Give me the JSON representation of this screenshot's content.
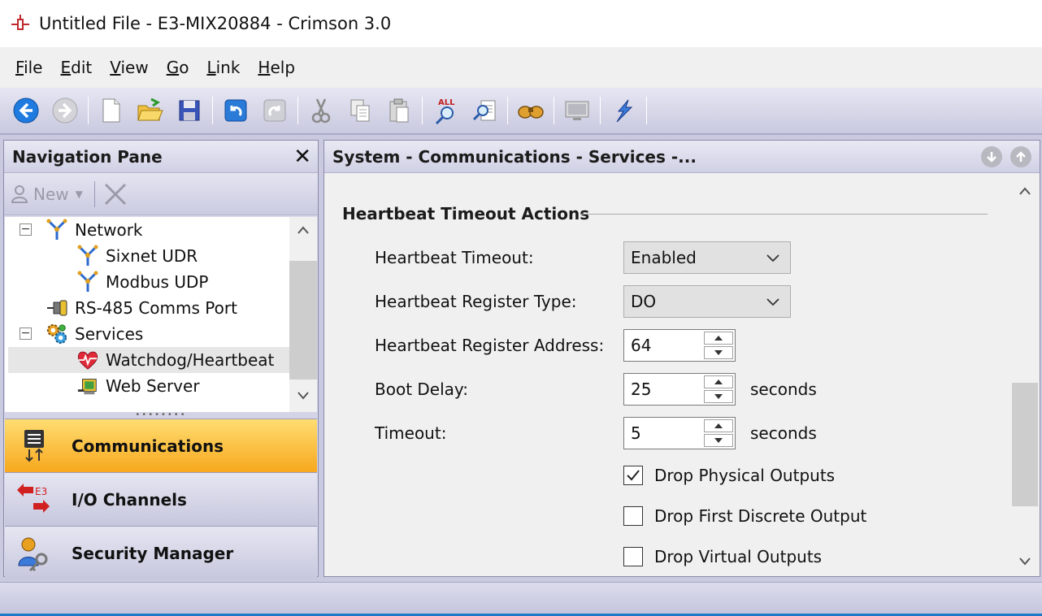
{
  "window": {
    "title": "Untitled File - E3-MIX20884 - Crimson 3.0"
  },
  "menu": [
    {
      "mnemonic": "F",
      "rest": "ile"
    },
    {
      "mnemonic": "E",
      "rest": "dit"
    },
    {
      "mnemonic": "V",
      "rest": "iew"
    },
    {
      "mnemonic": "G",
      "rest": "o"
    },
    {
      "mnemonic": "L",
      "rest": "ink"
    },
    {
      "mnemonic": "H",
      "rest": "elp"
    }
  ],
  "nav": {
    "title": "Navigation Pane",
    "new_label": "New",
    "tree": [
      {
        "label": "Network",
        "expander": "−"
      },
      {
        "label": "Sixnet UDR"
      },
      {
        "label": "Modbus UDP"
      },
      {
        "label": "RS-485 Comms Port"
      },
      {
        "label": "Services",
        "expander": "−"
      },
      {
        "label": "Watchdog/Heartbeat",
        "selected": true
      },
      {
        "label": "Web Server"
      }
    ],
    "categories": [
      {
        "label": "Communications",
        "active": true
      },
      {
        "label": "I/O Channels",
        "active": false
      },
      {
        "label": "Security Manager",
        "active": false
      }
    ]
  },
  "content": {
    "title": "System - Communications - Services -...",
    "section_title": "Heartbeat Timeout Actions",
    "fields": {
      "heartbeat_timeout": {
        "label": "Heartbeat Timeout:",
        "value": "Enabled"
      },
      "register_type": {
        "label": "Heartbeat Register Type:",
        "value": "DO"
      },
      "register_address": {
        "label": "Heartbeat Register Address:",
        "value": "64"
      },
      "boot_delay": {
        "label": "Boot Delay:",
        "value": "25",
        "units": "seconds"
      },
      "timeout": {
        "label": "Timeout:",
        "value": "5",
        "units": "seconds"
      }
    },
    "checkboxes": [
      {
        "label": "Drop Physical Outputs",
        "checked": true
      },
      {
        "label": "Drop First Discrete Output",
        "checked": false
      },
      {
        "label": "Drop Virtual Outputs",
        "checked": false
      }
    ]
  }
}
